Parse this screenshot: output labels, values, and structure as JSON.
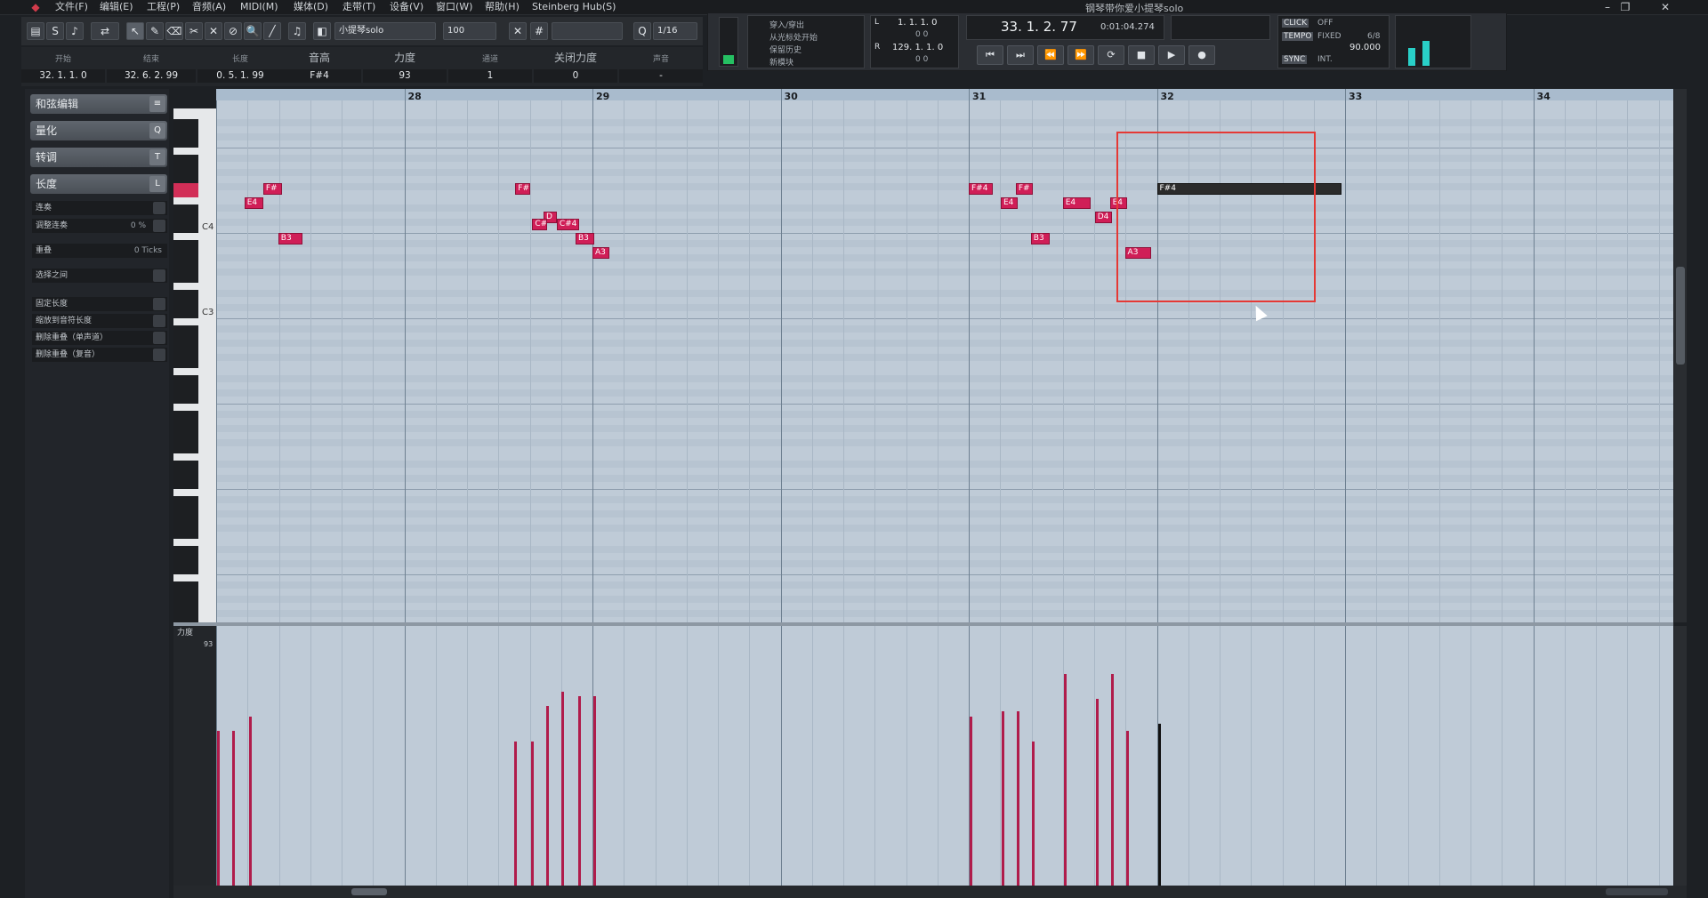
{
  "app": {
    "window_title": "钢琴带你爱小提琴solo",
    "menu": [
      "文件(F)",
      "编辑(E)",
      "工程(P)",
      "音频(A)",
      "MIDI(M)",
      "媒体(D)",
      "走带(T)",
      "设备(V)",
      "窗口(W)",
      "帮助(H)",
      "Steinberg Hub(S)"
    ]
  },
  "toolbar": {
    "track_name": "小提琴solo",
    "velocity": "100",
    "quantize": "1/16"
  },
  "infoline": {
    "columns": [
      {
        "label": "开始",
        "value": "32. 1. 1.   0"
      },
      {
        "label": "结束",
        "value": "32. 6. 2. 99"
      },
      {
        "label": "长度",
        "value": "0. 5. 1. 99"
      },
      {
        "label": "音高",
        "value": "F#4"
      },
      {
        "label": "力度",
        "value": "93"
      },
      {
        "label": "通道",
        "value": "1"
      },
      {
        "label": "关闭力度",
        "value": "0"
      },
      {
        "label": "声音",
        "value": "-"
      }
    ]
  },
  "transport": {
    "menu_lines": [
      "穿入/穿出",
      "从光标处开始",
      "保留历史",
      "新模块"
    ],
    "left_locator": "1.  1.  1.   0",
    "right_locator": "129.  1.  1.   0",
    "left_sub": "0      0",
    "right_sub": "0      0",
    "position": "33.  1.  2.  77",
    "time": "0:01:04.274",
    "click_label": "CLICK",
    "click_value": "OFF",
    "tempo_label": "TEMPO",
    "tempo_mode": "FIXED",
    "signature": "6/8",
    "tempo_value": "90.000",
    "sync_label": "SYNC",
    "sync_value": "INT."
  },
  "inspector": {
    "sections": [
      {
        "label": "和弦编辑",
        "key": "≡"
      },
      {
        "label": "量化",
        "key": "Q"
      },
      {
        "label": "转调",
        "key": "T"
      },
      {
        "label": "长度",
        "key": "L"
      }
    ],
    "rows": [
      {
        "label": "连奏",
        "value": ""
      },
      {
        "label": "调整连奏",
        "value": "0 %"
      },
      {
        "label": "重叠",
        "value": "0 Ticks"
      },
      {
        "label": "选择之间",
        "value": ""
      },
      {
        "label": "固定长度",
        "value": ""
      },
      {
        "label": "缩放到音符长度",
        "value": ""
      },
      {
        "label": "删除重叠（单声道）",
        "value": ""
      },
      {
        "label": "删除重叠（复音）",
        "value": ""
      }
    ]
  },
  "keyboard": {
    "c4_label": "C4",
    "c3_label": "C3"
  },
  "ruler": {
    "bars": [
      "28",
      "29",
      "30",
      "31",
      "32",
      "33",
      "34"
    ]
  },
  "notes": [
    {
      "label": "F#",
      "pitch": "F#4",
      "bar": 27.25,
      "len": 0.1
    },
    {
      "label": "E4",
      "pitch": "E4",
      "bar": 27.15,
      "len": 0.1
    },
    {
      "label": "B3",
      "pitch": "B3",
      "bar": 27.33,
      "len": 0.13
    },
    {
      "label": "F#",
      "pitch": "F#4",
      "bar": 28.59,
      "len": 0.08
    },
    {
      "label": "D",
      "pitch": "D4",
      "bar": 28.74,
      "len": 0.07
    },
    {
      "label": "C#",
      "pitch": "C#4",
      "bar": 28.68,
      "len": 0.08
    },
    {
      "label": "C#4",
      "pitch": "C#4",
      "bar": 28.81,
      "len": 0.12
    },
    {
      "label": "B3",
      "pitch": "B3",
      "bar": 28.91,
      "len": 0.1
    },
    {
      "label": "A3",
      "pitch": "A3",
      "bar": 29.0,
      "len": 0.09
    },
    {
      "label": "F#4",
      "pitch": "F#4",
      "bar": 31.0,
      "len": 0.13
    },
    {
      "label": "F#",
      "pitch": "F#4",
      "bar": 31.25,
      "len": 0.09
    },
    {
      "label": "E4",
      "pitch": "E4",
      "bar": 31.17,
      "len": 0.09
    },
    {
      "label": "E4",
      "pitch": "E4",
      "bar": 31.5,
      "len": 0.15
    },
    {
      "label": "E4",
      "pitch": "E4",
      "bar": 31.75,
      "len": 0.09
    },
    {
      "label": "D4",
      "pitch": "D4",
      "bar": 31.67,
      "len": 0.09
    },
    {
      "label": "B3",
      "pitch": "B3",
      "bar": 31.33,
      "len": 0.1
    },
    {
      "label": "A3",
      "pitch": "A3",
      "bar": 31.83,
      "len": 0.14
    },
    {
      "label": "F#4",
      "pitch": "F#4",
      "bar": 32.0,
      "len": 0.98,
      "selected": true
    }
  ],
  "velocity": {
    "lane_label": "力度",
    "max_label": "93",
    "bars": [
      {
        "bar": 27.0,
        "v": 0.62
      },
      {
        "bar": 27.08,
        "v": 0.62
      },
      {
        "bar": 27.17,
        "v": 0.68
      },
      {
        "bar": 28.58,
        "v": 0.58
      },
      {
        "bar": 28.67,
        "v": 0.58
      },
      {
        "bar": 28.75,
        "v": 0.72
      },
      {
        "bar": 28.83,
        "v": 0.78
      },
      {
        "bar": 28.92,
        "v": 0.76
      },
      {
        "bar": 29.0,
        "v": 0.76
      },
      {
        "bar": 31.0,
        "v": 0.68
      },
      {
        "bar": 31.17,
        "v": 0.7
      },
      {
        "bar": 31.25,
        "v": 0.7
      },
      {
        "bar": 31.33,
        "v": 0.58
      },
      {
        "bar": 31.5,
        "v": 0.85
      },
      {
        "bar": 31.67,
        "v": 0.75
      },
      {
        "bar": 31.75,
        "v": 0.85
      },
      {
        "bar": 31.83,
        "v": 0.62
      },
      {
        "bar": 32.0,
        "v": 0.65,
        "selected": true
      }
    ]
  }
}
